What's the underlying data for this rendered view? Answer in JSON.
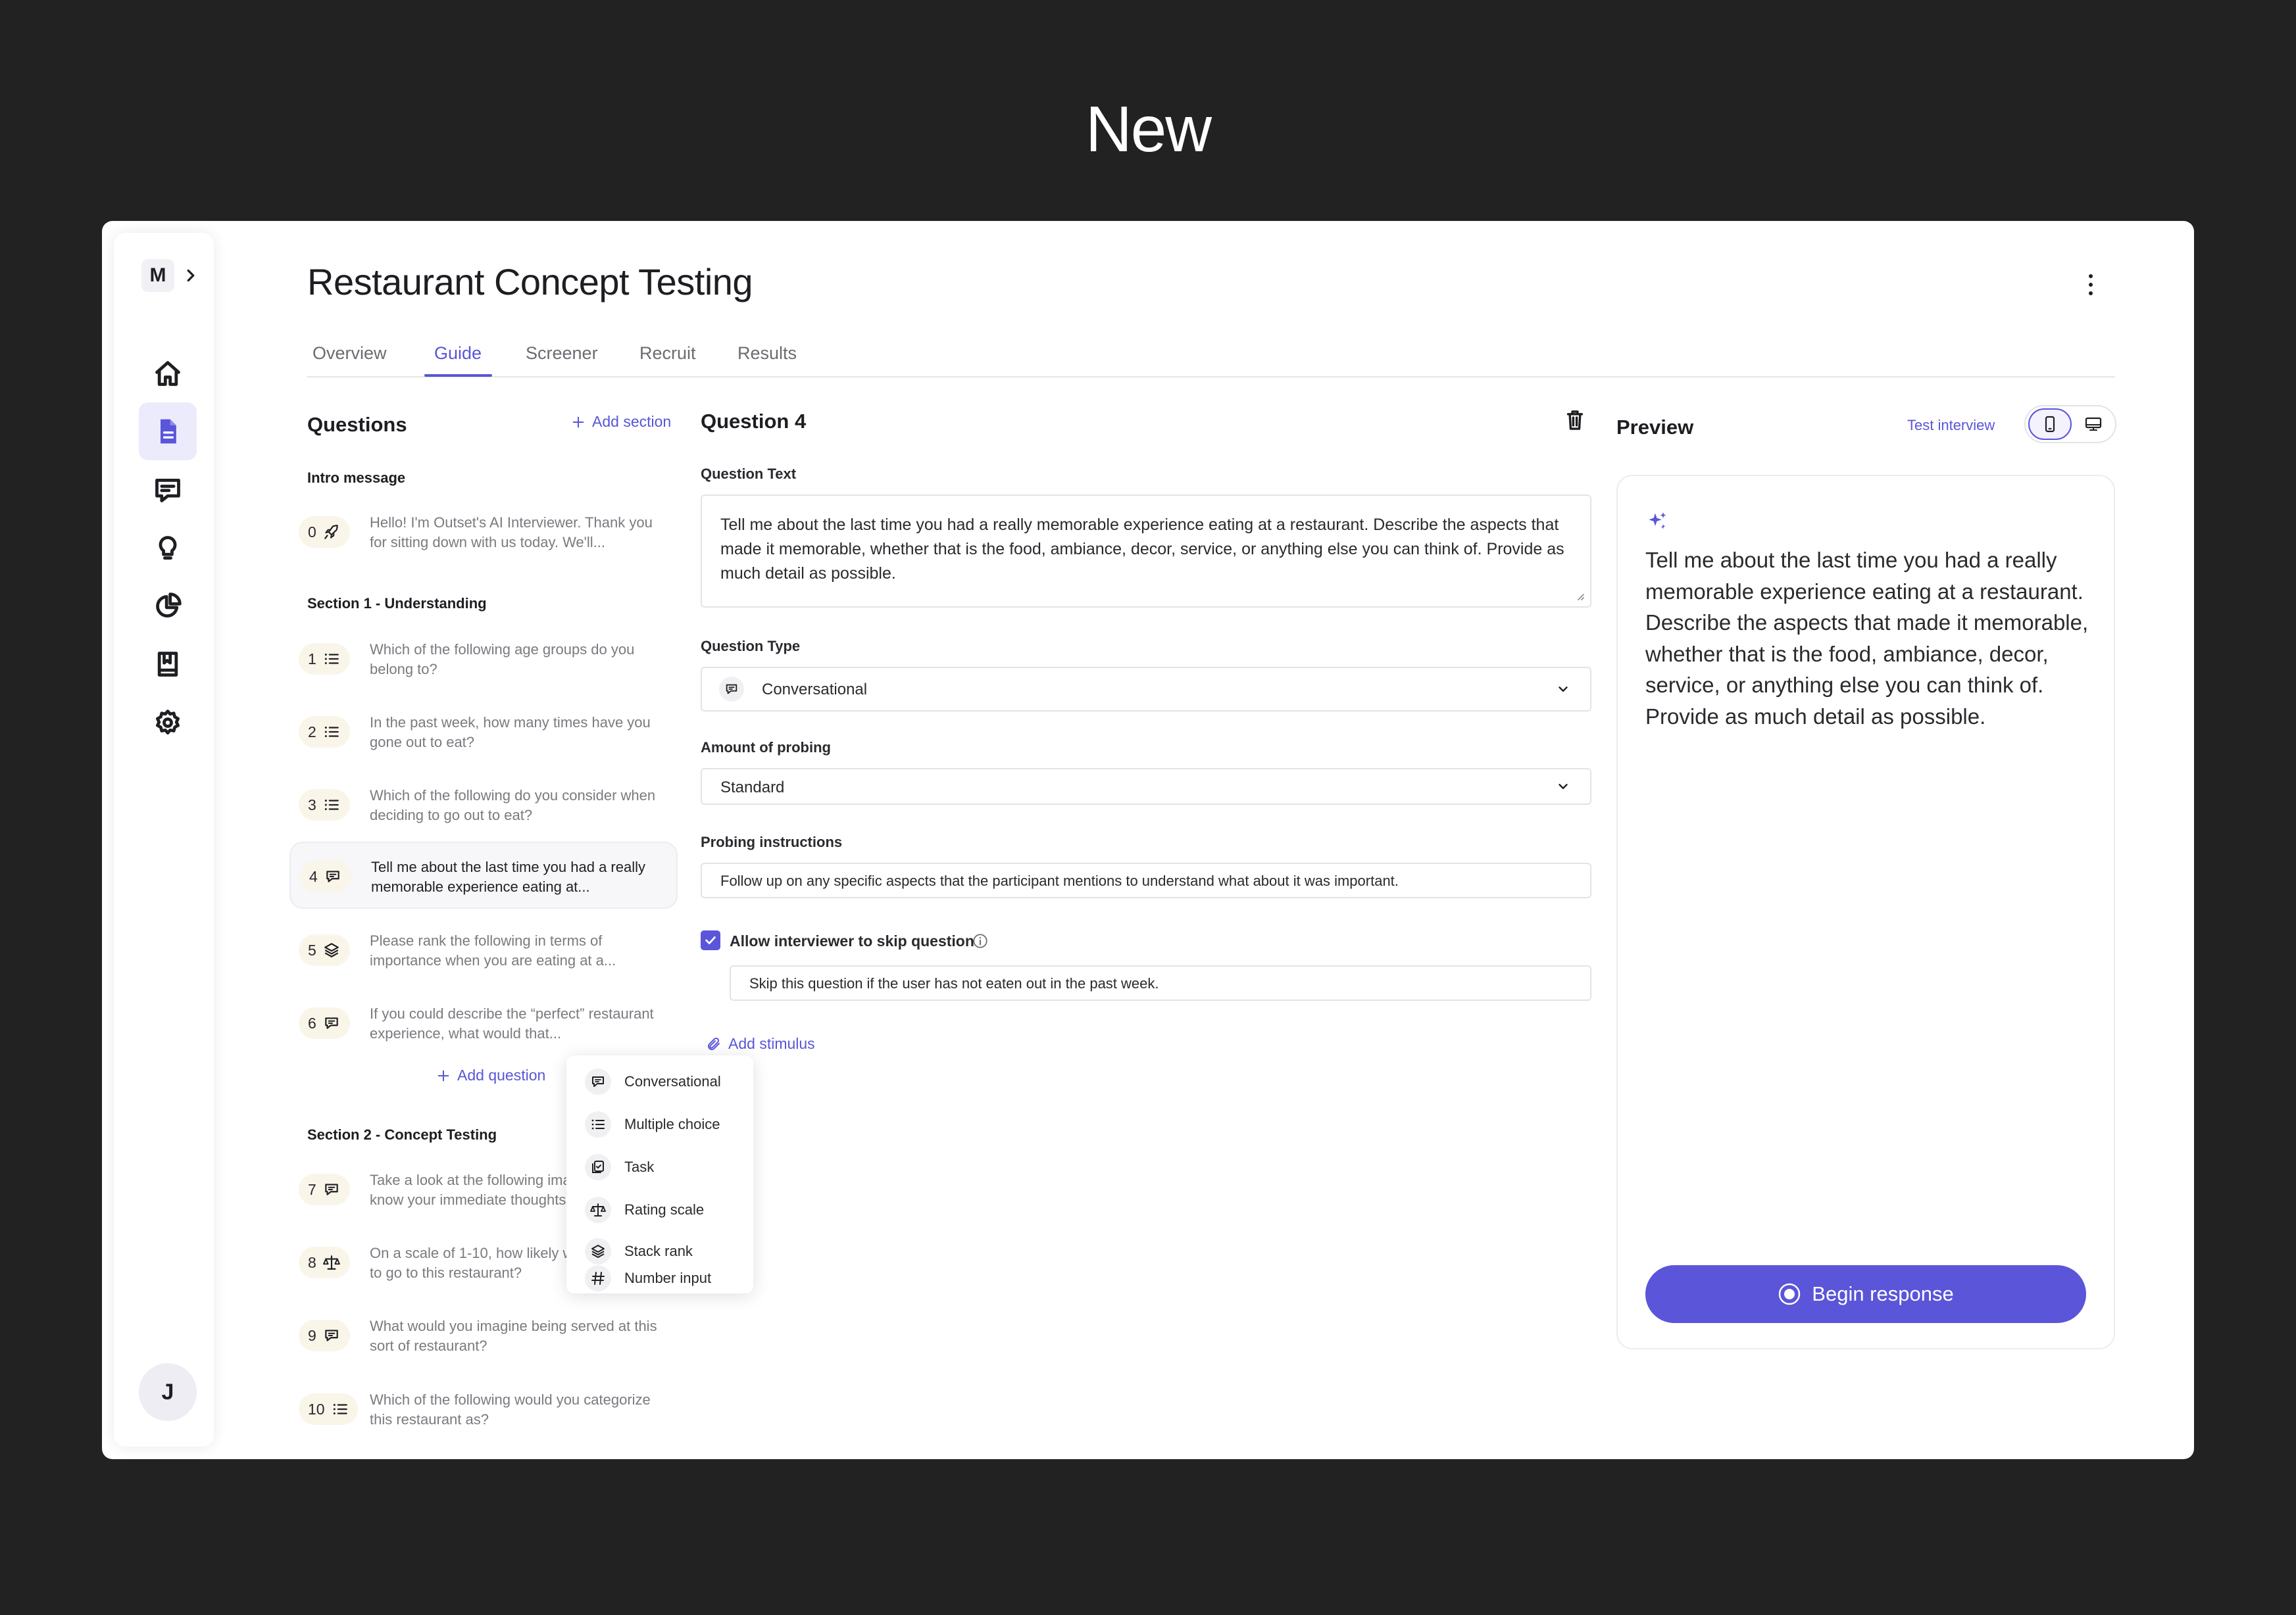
{
  "banner": {
    "title": "New"
  },
  "sidebar": {
    "workspace_initial": "M",
    "user_initial": "J",
    "items": [
      {
        "icon": "home-icon"
      },
      {
        "icon": "document-icon",
        "active": true
      },
      {
        "icon": "message-icon"
      },
      {
        "icon": "lightbulb-icon"
      },
      {
        "icon": "pie-chart-icon"
      },
      {
        "icon": "bookmark-book-icon"
      },
      {
        "icon": "gear-icon"
      }
    ]
  },
  "header": {
    "title": "Restaurant Concept Testing"
  },
  "tabs": [
    "Overview",
    "Guide",
    "Screener",
    "Recruit",
    "Results"
  ],
  "active_tab": "Guide",
  "questions": {
    "title": "Questions",
    "add_section": "Add section",
    "intro_label": "Intro message",
    "intro": {
      "num": "0",
      "icon": "rocket-icon",
      "text": "Hello! I'm Outset's AI Interviewer. Thank you for sitting down with us today. We'll..."
    },
    "section1_label": "Section 1 - Understanding",
    "section1": [
      {
        "num": "1",
        "icon": "list-icon",
        "text": "Which of the following age groups do you belong to?"
      },
      {
        "num": "2",
        "icon": "list-icon",
        "text": "In the past week, how many times have you gone out to eat?"
      },
      {
        "num": "3",
        "icon": "list-icon",
        "text": "Which of the following do you consider when deciding to go out to eat?"
      },
      {
        "num": "4",
        "icon": "chat-icon",
        "text": "Tell me about the last time you had a really memorable experience eating at...",
        "active": true
      },
      {
        "num": "5",
        "icon": "stack-icon",
        "text": "Please rank the following in terms of importance when you are eating at a..."
      },
      {
        "num": "6",
        "icon": "chat-icon",
        "text": "If you could describe the “perfect” restaurant experience, what would that..."
      }
    ],
    "add_question": "Add question",
    "section2_label": "Section 2 - Concept Testing",
    "section2": [
      {
        "num": "7",
        "icon": "chat-icon",
        "text": "Take a look at the following image and let me know your immediate thoughts"
      },
      {
        "num": "8",
        "icon": "scale-icon",
        "text": "On a scale of 1-10, how likely would you be to go to this restaurant?"
      },
      {
        "num": "9",
        "icon": "chat-icon",
        "text": "What would you imagine being served at this sort of restaurant?"
      },
      {
        "num": "10",
        "icon": "list-icon",
        "text": "Which of the following would you categorize this restaurant as?"
      }
    ]
  },
  "type_menu": [
    {
      "label": "Conversational",
      "icon": "chat-icon"
    },
    {
      "label": "Multiple choice",
      "icon": "list-icon"
    },
    {
      "label": "Task",
      "icon": "task-icon"
    },
    {
      "label": "Rating scale",
      "icon": "scale-icon"
    },
    {
      "label": "Stack rank",
      "icon": "stack-icon"
    },
    {
      "label": "Number input",
      "icon": "hash-icon"
    }
  ],
  "editor": {
    "title": "Question 4",
    "question_text_label": "Question Text",
    "question_text": "Tell me about the last time you had a really memorable experience eating at a restaurant. Describe the aspects that made it memorable, whether that is the food, ambiance, decor, service, or anything else you can think of. Provide as much detail as possible.",
    "question_type_label": "Question Type",
    "question_type": "Conversational",
    "probing_label": "Amount of probing",
    "probing": "Standard",
    "probing_instr_label": "Probing instructions",
    "probing_instr": "Follow up on any specific aspects that the participant mentions to understand what about it was important.",
    "skip_label": "Allow interviewer to skip question",
    "skip_checked": true,
    "skip_condition": "Skip this question if the user has not eaten out in the past week.",
    "add_stimulus": "Add stimulus"
  },
  "preview": {
    "title": "Preview",
    "test_interview": "Test interview",
    "text": "Tell me about the last time you had a really memorable experience eating at a restaurant. Describe the aspects that made it memorable, whether that is the food, ambiance, decor, service, or anything else you can think of. Provide as much detail as possible.",
    "begin": "Begin response"
  },
  "colors": {
    "accent": "#5a55d9",
    "background": "#222222",
    "number_badge": "#f9f5e9"
  }
}
